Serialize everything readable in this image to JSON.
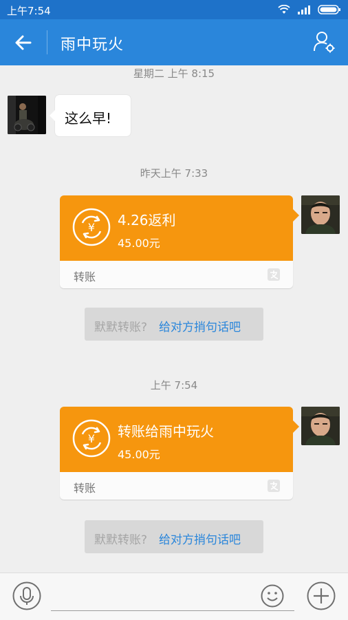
{
  "status_bar": {
    "time": "上午7:54"
  },
  "header": {
    "title": "雨中玩火"
  },
  "messages": {
    "ts1": "星期二 上午 8:15",
    "incoming_text": "这么早!",
    "ts2": "昨天上午 7:33",
    "card1": {
      "title": "4.26返利",
      "amount": "45.00元",
      "type": "转账"
    },
    "prompt1": {
      "gray": "默默转账?",
      "link": "给对方捎句话吧"
    },
    "ts3": "上午 7:54",
    "card2": {
      "title": "转账给雨中玩火",
      "amount": "45.00元",
      "type": "转账"
    },
    "prompt2": {
      "gray": "默默转账?",
      "link": "给对方捎句话吧"
    }
  },
  "icons": {
    "back": "back-arrow-icon",
    "profile": "contact-settings-icon",
    "coin": "transfer-coin-icon",
    "alipay": "alipay-icon",
    "mic": "microphone-icon",
    "emoji": "emoji-icon",
    "plus": "plus-icon"
  },
  "colors": {
    "header": "#2a86db",
    "statusbar": "#1e72c9",
    "card": "#f6960e",
    "link": "#2a86db"
  }
}
